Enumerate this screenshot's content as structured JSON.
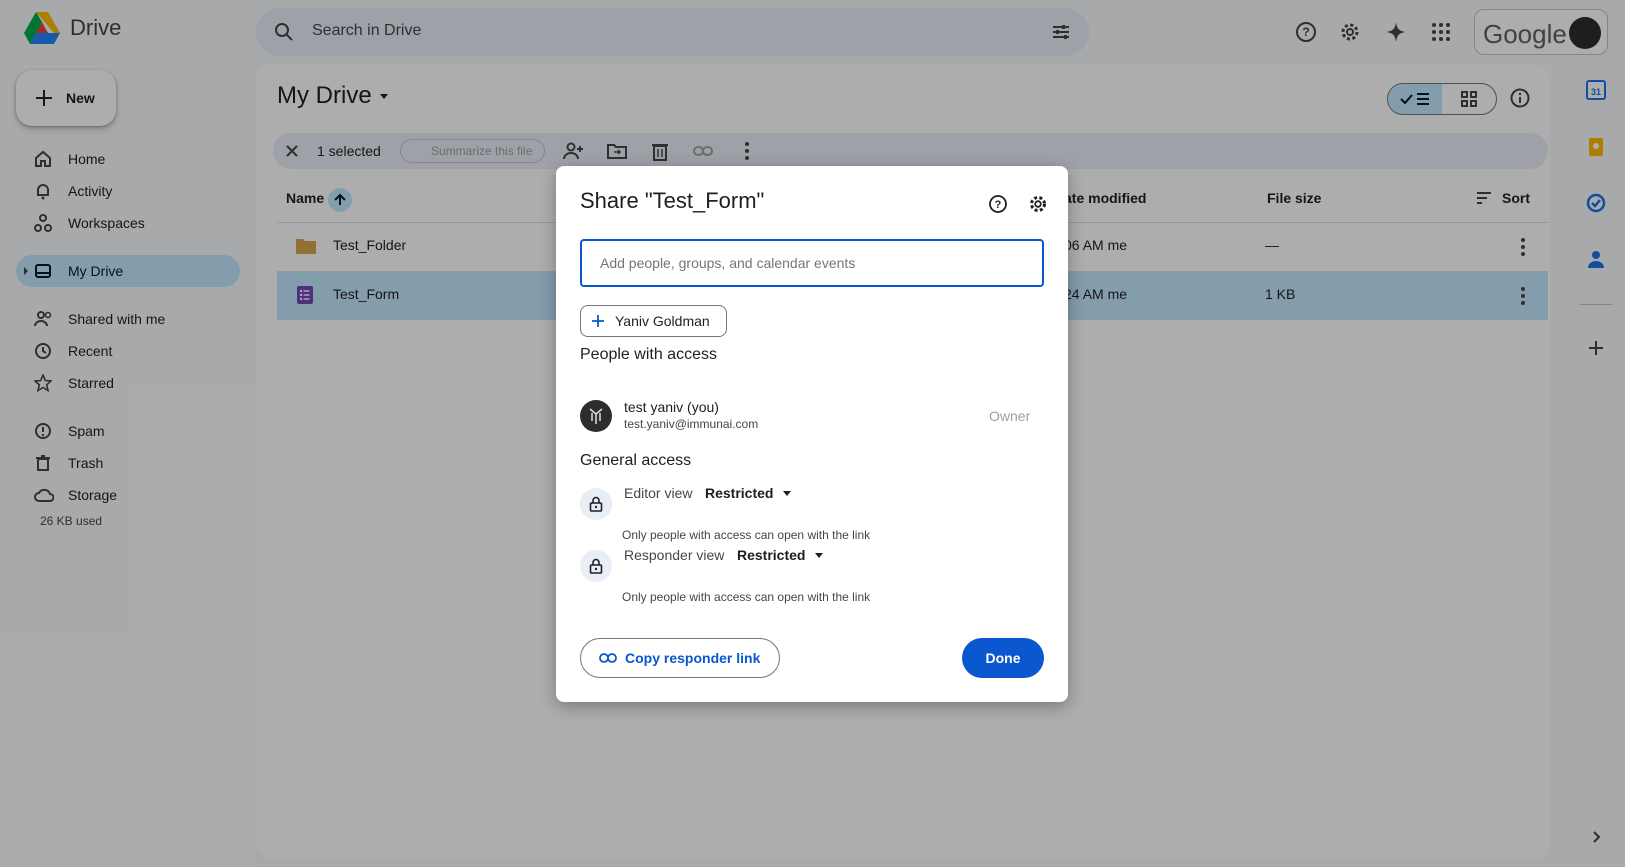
{
  "app": {
    "name": "Drive"
  },
  "search": {
    "placeholder": "Search in Drive"
  },
  "account": {
    "brand": "Google"
  },
  "sidebar": {
    "new_label": "New",
    "items": [
      {
        "label": "Home"
      },
      {
        "label": "Activity"
      },
      {
        "label": "Workspaces"
      },
      {
        "label": "My Drive"
      },
      {
        "label": "Shared with me"
      },
      {
        "label": "Recent"
      },
      {
        "label": "Starred"
      },
      {
        "label": "Spam"
      },
      {
        "label": "Trash"
      },
      {
        "label": "Storage"
      }
    ],
    "storage_used": "26 KB used"
  },
  "main": {
    "title": "My Drive",
    "selection": {
      "count": "1 selected",
      "summarize": "Summarize this file"
    },
    "columns": {
      "name": "Name",
      "modified": "ate modified",
      "size": "File size",
      "sort": "Sort"
    },
    "rows": [
      {
        "name": "Test_Folder",
        "modified": "06 AM me",
        "size": "—"
      },
      {
        "name": "Test_Form",
        "modified": "24 AM me",
        "size": "1 KB"
      }
    ]
  },
  "share_dialog": {
    "title": "Share \"Test_Form\"",
    "input_placeholder": "Add people, groups, and calendar events",
    "suggestion_chip": "Yaniv Goldman",
    "people_heading": "People with access",
    "person": {
      "name": "test yaniv (you)",
      "email": "test.yaniv@immunai.com",
      "role": "Owner"
    },
    "general_heading": "General access",
    "editor": {
      "label": "Editor view",
      "value": "Restricted",
      "desc": "Only people with access can open with the link"
    },
    "responder": {
      "label": "Responder view",
      "value": "Restricted",
      "desc": "Only people with access can open with the link"
    },
    "copy_link": "Copy responder link",
    "done": "Done"
  },
  "colors": {
    "accent": "#0b57d0",
    "selected_bg": "#c2e7ff",
    "scrim": "rgba(0,0,0,0.32)"
  }
}
